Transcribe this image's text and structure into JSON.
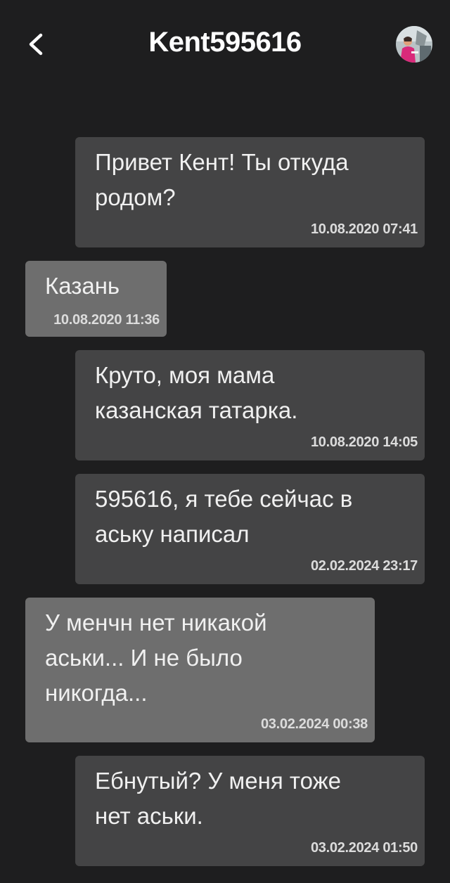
{
  "header": {
    "title": "Kent595616",
    "back_icon": "chevron-left-icon",
    "avatar_icon": "user-avatar"
  },
  "colors": {
    "background": "#1e1e1f",
    "outgoing_bubble": "#444445",
    "incoming_bubble": "#6e6e6e",
    "text": "#f0f0f0"
  },
  "messages": [
    {
      "direction": "outgoing",
      "text": "Привет Кент! Ты откуда\nродом?",
      "time": "10.08.2020 07:41"
    },
    {
      "direction": "incoming",
      "text": "Казань",
      "time": "10.08.2020 11:36"
    },
    {
      "direction": "outgoing",
      "text": "Круто, моя мама\nказанская татарка.",
      "time": "10.08.2020 14:05"
    },
    {
      "direction": "outgoing",
      "text": "595616, я тебе сейчас в\nаську написал",
      "time": "02.02.2024 23:17"
    },
    {
      "direction": "incoming",
      "text": "У менчн нет никакой\naськи... И не было\nникогда...",
      "time": "03.02.2024 00:38"
    },
    {
      "direction": "outgoing",
      "text": "Ебнутый? У меня тоже\nнет аськи.",
      "time": "03.02.2024 01:50"
    }
  ]
}
